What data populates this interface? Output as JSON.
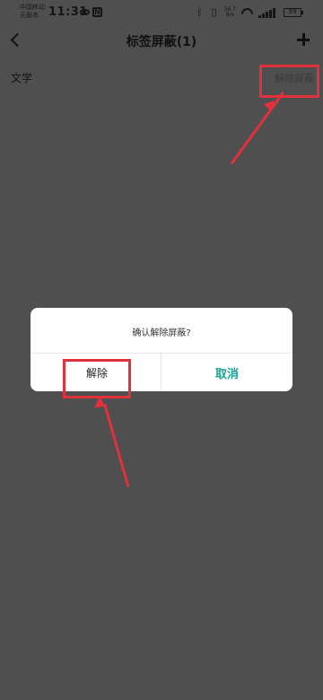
{
  "status_bar": {
    "carrier_line1": "中国移动",
    "carrier_line2": "无服务",
    "time": "11:31",
    "network_speed": "36.7\nB/s",
    "battery_level": "99"
  },
  "header": {
    "back_icon": "chevron-left-icon",
    "title": "标签屏蔽(1)",
    "add_icon": "plus-icon"
  },
  "tags": [
    {
      "name": "文学",
      "action_label": "解除屏蔽"
    }
  ],
  "dialog": {
    "message": "确认解除屏蔽?",
    "confirm_label": "解除",
    "cancel_label": "取消"
  },
  "colors": {
    "overlay_background": "#4f4f4f",
    "cancel_accent": "#1aa297",
    "annotation_red": "#e2303d"
  }
}
